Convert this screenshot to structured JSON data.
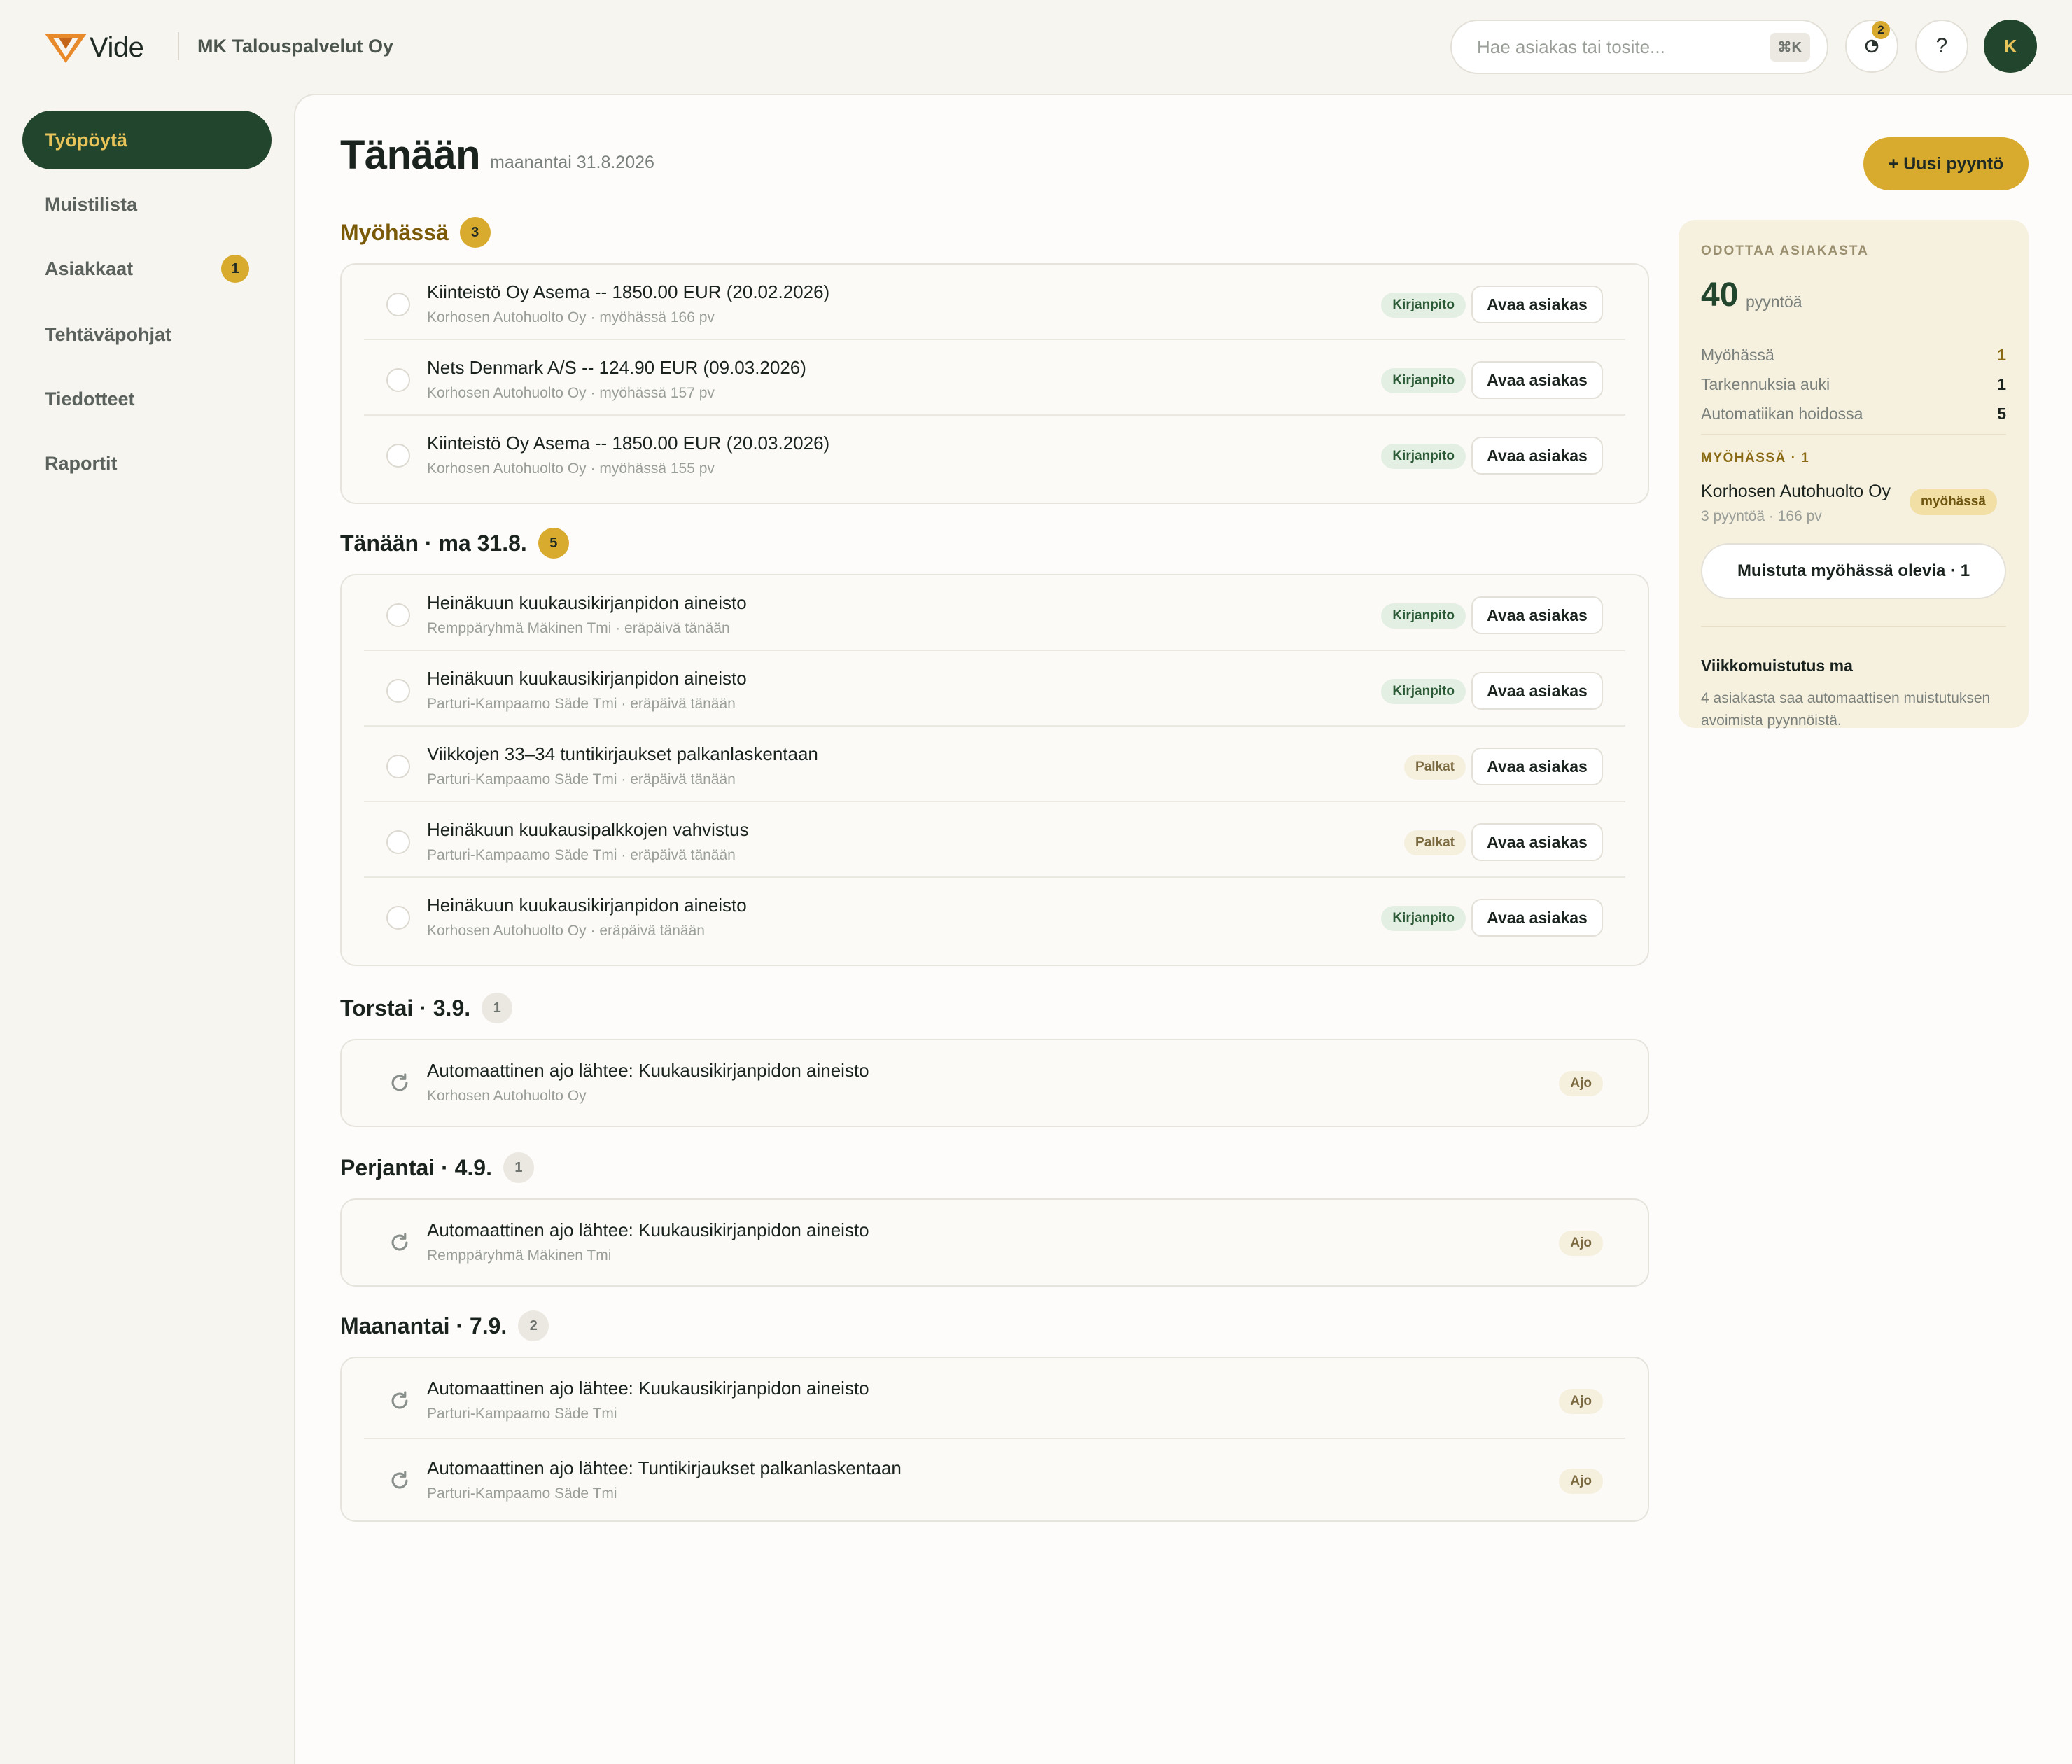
{
  "header": {
    "logo_text": "Vide",
    "company": "MK Talouspalvelut Oy",
    "search_placeholder": "Hae asiakas tai tosite...",
    "search_shortcut": "⌘K",
    "notifications_count": "2",
    "help_label": "?",
    "avatar_initial": "K"
  },
  "sidebar": {
    "items": [
      {
        "label": "Työpöytä",
        "active": true
      },
      {
        "label": "Muistilista"
      },
      {
        "label": "Asiakkaat",
        "count": "1"
      },
      {
        "label": "Tehtäväpohjat"
      },
      {
        "label": "Tiedotteet"
      },
      {
        "label": "Raportit"
      }
    ]
  },
  "main": {
    "title": "Tänään",
    "date": "maanantai 31.8.2026",
    "new_button": "+ Uusi pyyntö",
    "open_label": "Avaa asiakas",
    "sections": [
      {
        "title": "Myöhässä",
        "count": "3",
        "rows": [
          {
            "title": "Kiinteistö Oy Asema -- 1850.00 EUR (20.02.2026)",
            "sub": "Korhosen Autohuolto Oy · myöhässä 166 pv",
            "tag": "Kirjanpito"
          },
          {
            "title": "Nets Denmark A/S -- 124.90 EUR (09.03.2026)",
            "sub": "Korhosen Autohuolto Oy · myöhässä 157 pv",
            "tag": "Kirjanpito"
          },
          {
            "title": "Kiinteistö Oy Asema -- 1850.00 EUR (20.03.2026)",
            "sub": "Korhosen Autohuolto Oy · myöhässä 155 pv",
            "tag": "Kirjanpito"
          }
        ]
      },
      {
        "title": "Tänään · ma 31.8.",
        "count": "5",
        "rows": [
          {
            "title": "Heinäkuun kuukausikirjanpidon aineisto",
            "sub": "Remppäryhmä Mäkinen Tmi · eräpäivä tänään",
            "tag": "Kirjanpito"
          },
          {
            "title": "Heinäkuun kuukausikirjanpidon aineisto",
            "sub": "Parturi-Kampaamo Säde Tmi · eräpäivä tänään",
            "tag": "Kirjanpito"
          },
          {
            "title": "Viikkojen 33–34 tuntikirjaukset palkanlaskentaan",
            "sub": "Parturi-Kampaamo Säde Tmi · eräpäivä tänään",
            "tag": "Palkat"
          },
          {
            "title": "Heinäkuun kuukausipalkkojen vahvistus",
            "sub": "Parturi-Kampaamo Säde Tmi · eräpäivä tänään",
            "tag": "Palkat"
          },
          {
            "title": "Heinäkuun kuukausikirjanpidon aineisto",
            "sub": "Korhosen Autohuolto Oy · eräpäivä tänään",
            "tag": "Kirjanpito"
          }
        ]
      },
      {
        "title": "Torstai · 3.9.",
        "count": "1",
        "rows": [
          {
            "title": "Automaattinen ajo lähtee: Kuukausikirjanpidon aineisto",
            "sub": "Korhosen Autohuolto Oy",
            "tag": "Ajo"
          }
        ]
      },
      {
        "title": "Perjantai · 4.9.",
        "count": "1",
        "rows": [
          {
            "title": "Automaattinen ajo lähtee: Kuukausikirjanpidon aineisto",
            "sub": "Remppäryhmä Mäkinen Tmi",
            "tag": "Ajo"
          }
        ]
      },
      {
        "title": "Maanantai · 7.9.",
        "count": "2",
        "rows": [
          {
            "title": "Automaattinen ajo lähtee: Kuukausikirjanpidon aineisto",
            "sub": "Parturi-Kampaamo Säde Tmi",
            "tag": "Ajo"
          },
          {
            "title": "Automaattinen ajo lähtee: Tuntikirjaukset palkanlaskentaan",
            "sub": "Parturi-Kampaamo Säde Tmi",
            "tag": "Ajo"
          }
        ]
      }
    ]
  },
  "side": {
    "label": "ODOTTAA ASIAKASTA",
    "total": "40",
    "total_unit": "pyyntöä",
    "stats": [
      {
        "label": "Myöhässä",
        "value": "1"
      },
      {
        "label": "Tarkennuksia auki",
        "value": "1"
      },
      {
        "label": "Automatiikan hoidossa",
        "value": "5"
      }
    ],
    "late_label": "MYÖHÄSSÄ · 1",
    "late_client": "Korhosen Autohuolto Oy",
    "late_sub": "3 pyyntöä · 166 pv",
    "late_tag": "myöhässä",
    "remind_button": "Muistuta myöhässä olevia · 1",
    "weekly_title": "Viikkomuistutus ma",
    "weekly_text": "4 asiakasta saa automaattisen muistutuksen avoimista pyynnöistä."
  }
}
